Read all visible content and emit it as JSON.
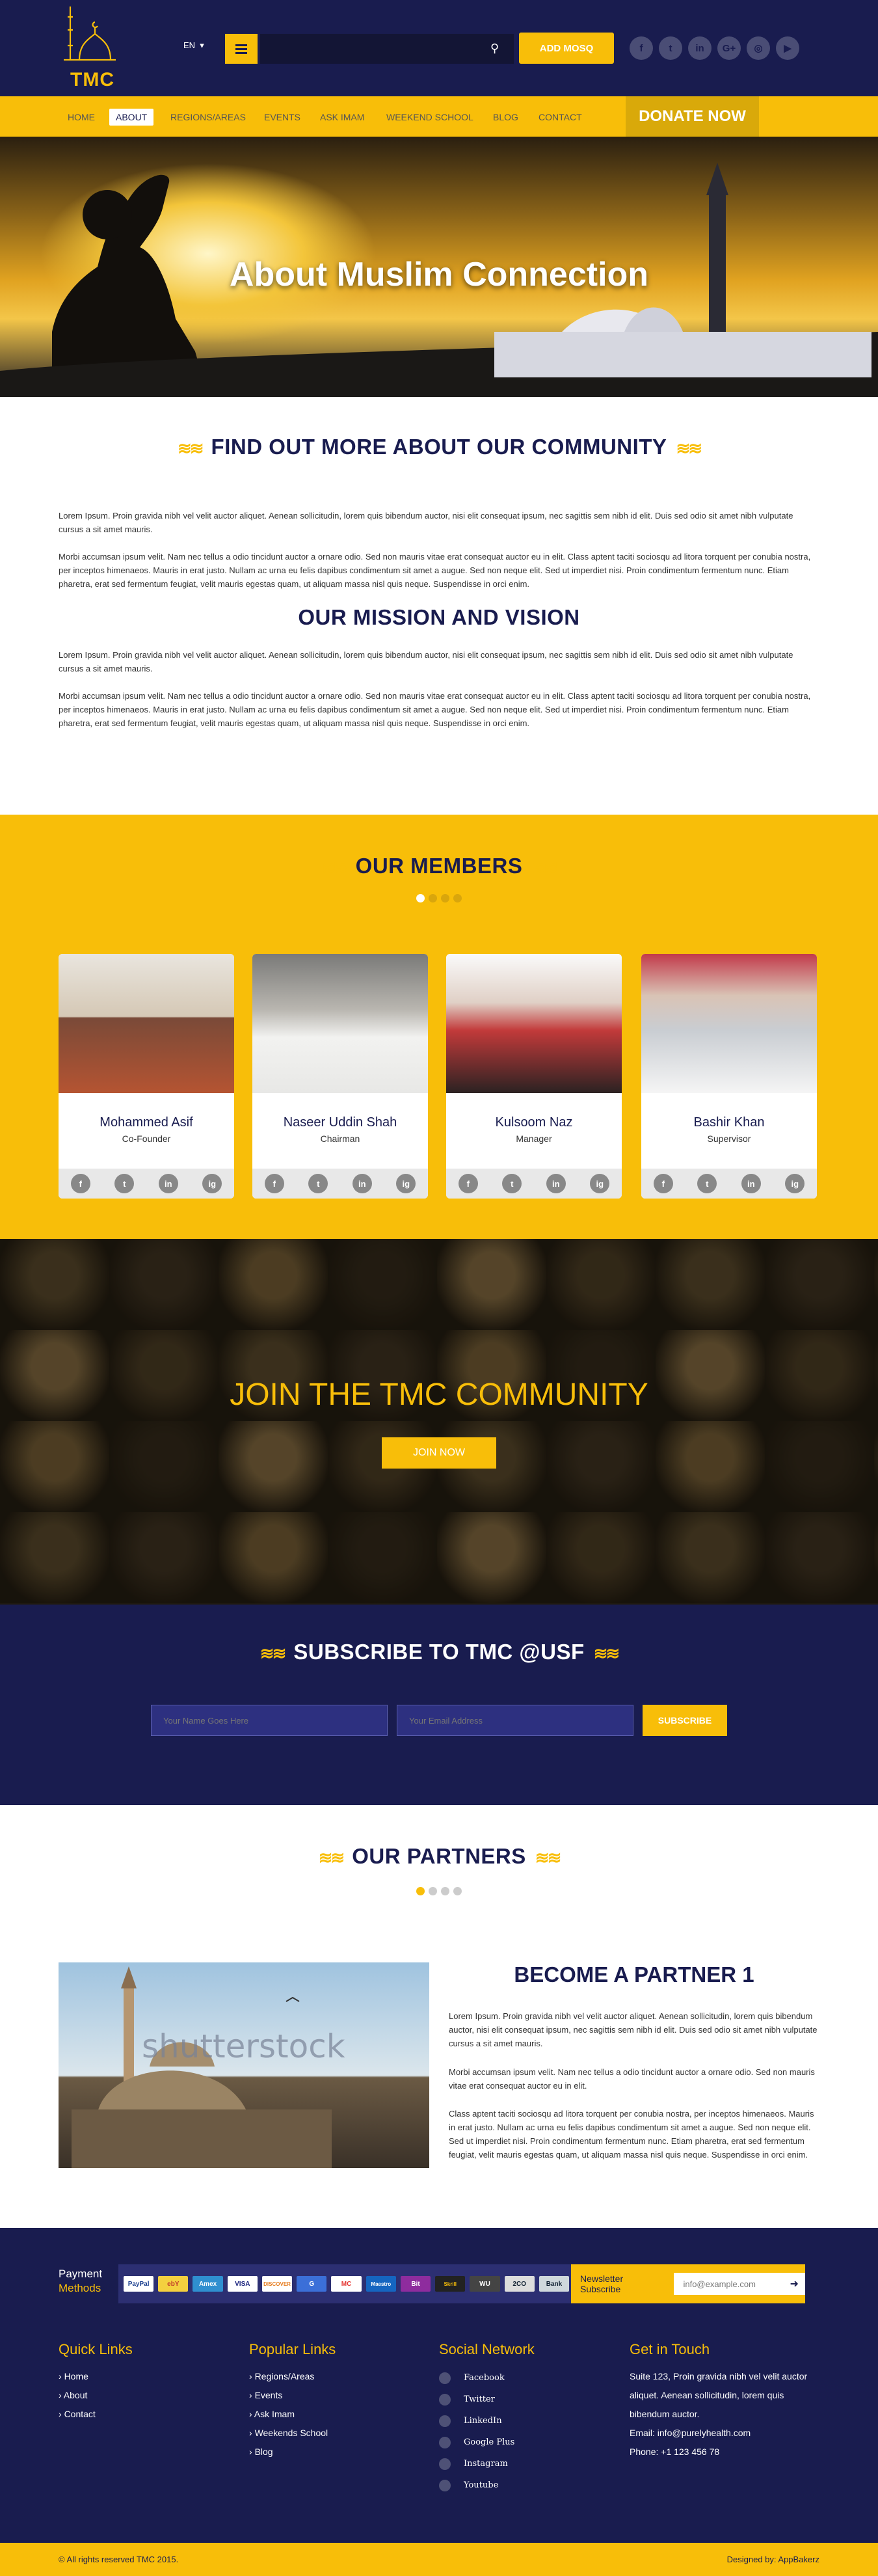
{
  "header": {
    "logo_text": "TMC",
    "language": "EN",
    "search_placeholder": "",
    "add_mosq": "ADD MOSQ",
    "social_icons": [
      "facebook-icon",
      "twitter-icon",
      "linkedin-icon",
      "google-plus-icon",
      "instagram-icon",
      "youtube-icon"
    ]
  },
  "nav": {
    "items": [
      "HOME",
      "ABOUT",
      "REGIONS/AREAS",
      "EVENTS",
      "ASK IMAM",
      "WEEKEND SCHOOL",
      "BLOG",
      "CONTACT"
    ],
    "active": "ABOUT",
    "donate": "DONATE NOW"
  },
  "hero": {
    "title": "About Muslim Connection"
  },
  "about": {
    "heading": "FIND OUT MORE ABOUT OUR COMMUNITY",
    "p1": "Lorem Ipsum. Proin gravida nibh vel velit auctor aliquet. Aenean sollicitudin, lorem quis bibendum auctor, nisi elit consequat ipsum, nec sagittis sem nibh id elit. Duis sed odio sit amet nibh vulputate cursus a sit amet mauris.",
    "p2": "Morbi accumsan ipsum velit. Nam nec tellus a odio tincidunt auctor a ornare odio. Sed non mauris vitae erat consequat auctor eu in elit. Class aptent taciti sociosqu ad litora torquent per conubia nostra, per inceptos himenaeos. Mauris in erat justo. Nullam ac urna eu felis dapibus condimentum sit amet a augue. Sed non neque elit. Sed ut imperdiet nisi. Proin condimentum fermentum nunc. Etiam pharetra, erat sed fermentum feugiat, velit mauris egestas quam, ut aliquam massa nisl quis neque. Suspendisse in orci enim."
  },
  "mission": {
    "heading": "OUR MISSION AND VISION",
    "p1": "Lorem Ipsum. Proin gravida nibh vel velit auctor aliquet. Aenean sollicitudin, lorem quis bibendum auctor, nisi elit consequat ipsum, nec sagittis sem nibh id elit. Duis sed odio sit amet nibh vulputate cursus a sit amet mauris.",
    "p2": "Morbi accumsan ipsum velit. Nam nec tellus a odio tincidunt auctor a ornare odio. Sed non mauris vitae erat consequat auctor eu in elit. Class aptent taciti sociosqu ad litora torquent per conubia nostra, per inceptos himenaeos. Mauris in erat justo. Nullam ac urna eu felis dapibus condimentum sit amet a augue. Sed non neque elit. Sed ut imperdiet nisi. Proin condimentum fermentum nunc. Etiam pharetra, erat sed fermentum feugiat, velit mauris egestas quam, ut aliquam massa nisl quis neque. Suspendisse in orci enim."
  },
  "members": {
    "heading": "OUR MEMBERS",
    "list": [
      {
        "name": "Mohammed Asif",
        "role": "Co-Founder",
        "photo_color": "#7a4a38"
      },
      {
        "name": "Naseer Uddin Shah",
        "role": "Chairman",
        "photo_color": "#b9b6b0"
      },
      {
        "name": "Kulsoom Naz",
        "role": "Manager",
        "photo_color": "#c23a3a"
      },
      {
        "name": "Bashir Khan",
        "role": "Supervisor",
        "photo_color": "#c9cdd2"
      }
    ],
    "card_social": [
      "f",
      "t",
      "in",
      "ig"
    ]
  },
  "join": {
    "title": "JOIN THE TMC COMMUNITY",
    "button": "JOIN NOW"
  },
  "subscribe": {
    "heading": "SUBSCRIBE TO TMC @USF",
    "name_placeholder": "Your Name Goes Here",
    "email_placeholder": "Your Email Address",
    "button": "SUBSCRIBE"
  },
  "partners": {
    "heading": "OUR PARTNERS",
    "watermark": "shutterstock",
    "title": "BECOME A PARTNER 1",
    "p1": "Lorem Ipsum. Proin gravida nibh vel velit auctor aliquet. Aenean sollicitudin, lorem quis bibendum auctor, nisi elit consequat ipsum, nec sagittis sem nibh id elit. Duis sed odio sit amet nibh vulputate cursus a sit amet mauris.",
    "p2": "Morbi accumsan ipsum velit. Nam nec tellus a odio tincidunt auctor a ornare odio. Sed non mauris vitae erat consequat auctor eu in elit.",
    "p3": "Class aptent taciti sociosqu ad litora torquent per conubia nostra, per inceptos himenaeos. Mauris in erat justo. Nullam ac urna eu felis dapibus condimentum sit amet a augue. Sed non neque elit. Sed ut imperdiet nisi. Proin condimentum fermentum nunc. Etiam pharetra, erat sed fermentum feugiat, velit mauris egestas quam, ut aliquam massa nisl quis neque. Suspendisse in orci enim."
  },
  "footer": {
    "payment_label_1": "Payment",
    "payment_label_2": "Methods",
    "payment_methods": [
      "PayPal",
      "ebY",
      "Amex",
      "VISA",
      "DISCOVER",
      "G",
      "MC",
      "Maestro",
      "Bit",
      "Skrill",
      "WU",
      "2CO",
      "Bank"
    ],
    "newsletter_label": "Newsletter Subscribe",
    "newsletter_placeholder": "info@example.com",
    "quick_links": {
      "title": "Quick Links",
      "items": [
        "Home",
        "About",
        "Contact"
      ]
    },
    "popular_links": {
      "title": "Popular Links",
      "items": [
        "Regions/Areas",
        "Events",
        "Ask Imam",
        "Weekends School",
        "Blog"
      ]
    },
    "social_network": {
      "title": "Social Network",
      "items": [
        "Facebook",
        "Twitter",
        "LinkedIn",
        "Google Plus",
        "Instagram",
        "Youtube"
      ]
    },
    "get_in_touch": {
      "title": "Get in Touch",
      "address": "Suite 123, Proin gravida nibh vel velit auctor aliquet. Aenean sollicitudin, lorem quis bibendum auctor.",
      "email": "Email: info@purelyhealth.com",
      "phone": "Phone: +1 123 456 78"
    },
    "copyright": "© All rights reserved TMC 2015.",
    "designed_by": "Designed by: AppBakerz"
  },
  "colors": {
    "navy": "#191c4f",
    "gold": "#f8be09"
  }
}
